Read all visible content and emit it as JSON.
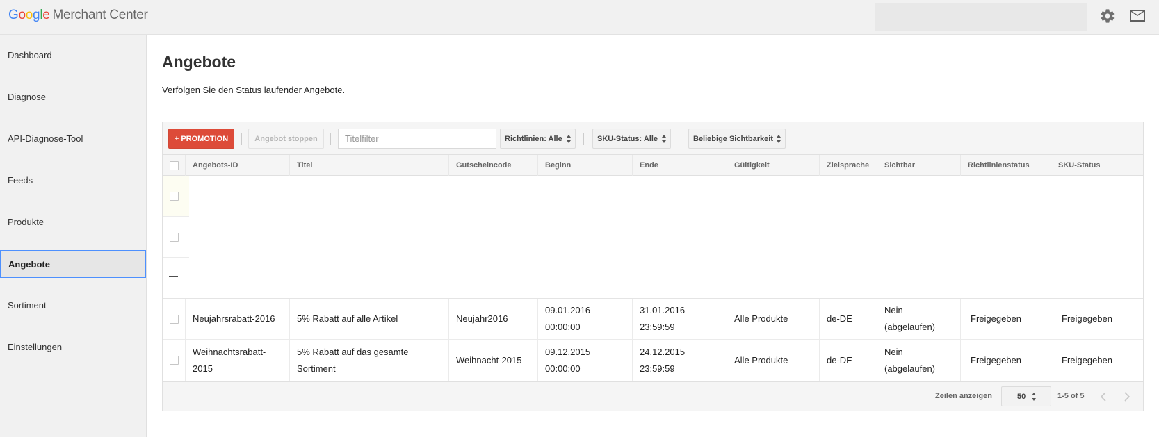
{
  "header": {
    "logo_google": [
      "G",
      "o",
      "o",
      "g",
      "l",
      "e"
    ],
    "logo_product": "Merchant Center",
    "search_value": "",
    "settings_icon": "gear-icon",
    "mail_icon": "mail-icon"
  },
  "sidebar": {
    "items": [
      {
        "label": "Dashboard",
        "active": false
      },
      {
        "label": "Diagnose",
        "active": false
      },
      {
        "label": "API-Diagnose-Tool",
        "active": false
      },
      {
        "label": "Feeds",
        "active": false
      },
      {
        "label": "Produkte",
        "active": false
      },
      {
        "label": "Angebote",
        "active": true
      },
      {
        "label": "Sortiment",
        "active": false
      },
      {
        "label": "Einstellungen",
        "active": false
      }
    ]
  },
  "main": {
    "title": "Angebote",
    "subtitle": "Verfolgen Sie den Status laufender Angebote."
  },
  "toolbar": {
    "promo_label": "+ PROMOTION",
    "stop_label": "Angebot stoppen",
    "filter_placeholder": "Titelfilter",
    "filter_value": "",
    "policy_filter": "Richtlinien: Alle",
    "sku_filter": "SKU-Status: Alle",
    "visibility_filter": "Beliebige Sichtbarkeit"
  },
  "table": {
    "columns": [
      "Angebots-ID",
      "Titel",
      "Gutscheincode",
      "Beginn",
      "Ende",
      "Gültigkeit",
      "Zielsprache",
      "Sichtbar",
      "Richtlinienstatus",
      "SKU-Status"
    ],
    "rows": [
      {
        "id": "Neujahrsrabatt-2016",
        "title": "5% Rabatt auf alle Artikel",
        "code": "Neujahr2016",
        "start_date": "09.01.2016",
        "start_time": "00:00:00",
        "end_date": "31.01.2016",
        "end_time": "23:59:59",
        "validity": "Alle Produkte",
        "language": "de-DE",
        "visible_1": "Nein",
        "visible_2": "(abgelaufen)",
        "policy_status": "Freigegeben",
        "sku_status": "Freigegeben"
      },
      {
        "id_1": "Weihnachtsrabatt-",
        "id_2": "2015",
        "title_1": "5% Rabatt auf das gesamte",
        "title_2": "Sortiment",
        "code": "Weihnacht-2015",
        "start_date": "09.12.2015",
        "start_time": "00:00:00",
        "end_date": "24.12.2015",
        "end_time": "23:59:59",
        "validity": "Alle Produkte",
        "language": "de-DE",
        "visible_1": "Nein",
        "visible_2": "(abgelaufen)",
        "policy_status": "Freigegeben",
        "sku_status": "Freigegeben"
      }
    ],
    "collapse_symbol": "—"
  },
  "footer": {
    "rows_label": "Zeilen anzeigen",
    "rows_value": "50",
    "range": "1-5 of 5",
    "prev_icon": "chevron-left-icon",
    "next_icon": "chevron-right-icon"
  },
  "colors": {
    "primary_button": "#dd4b39",
    "active_border": "#4d90fe",
    "highlight_row": "#fdfdf2"
  }
}
